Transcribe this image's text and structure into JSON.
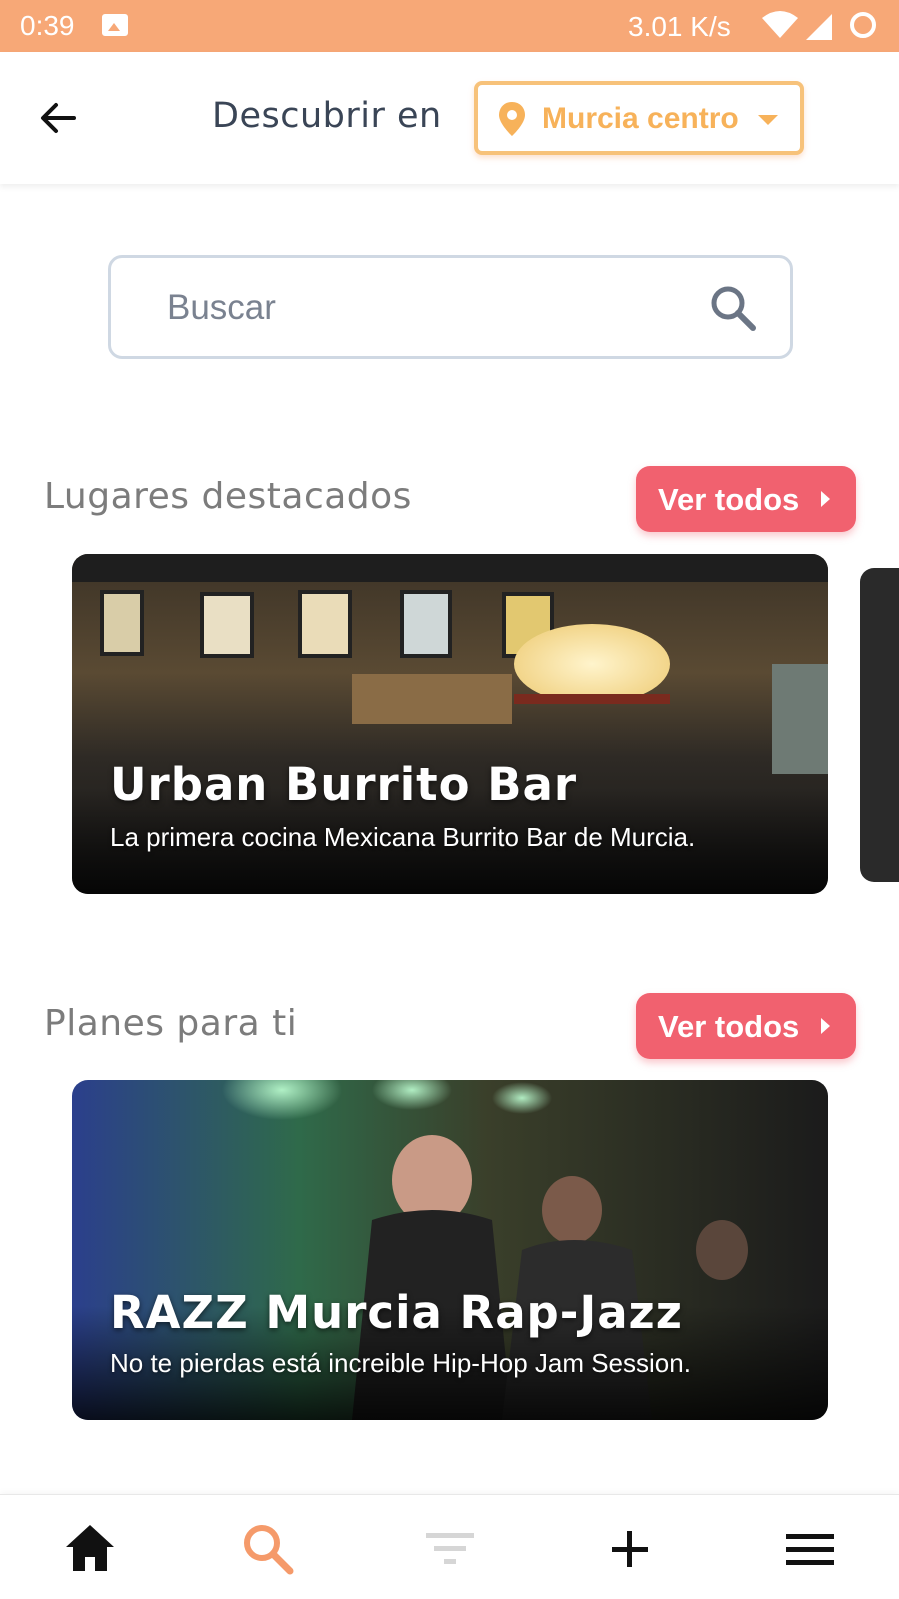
{
  "status_bar": {
    "time": "0:39",
    "speed": "3.01 K/s"
  },
  "header": {
    "title": "Descubrir en",
    "location": "Murcia centro"
  },
  "search": {
    "placeholder": "Buscar"
  },
  "sections": [
    {
      "title": "Lugares destacados",
      "see_all": "Ver todos",
      "card": {
        "title": "Urban Burrito Bar",
        "subtitle": "La primera cocina Mexicana Burrito Bar de Murcia."
      }
    },
    {
      "title": "Planes para ti",
      "see_all": "Ver todos",
      "card": {
        "title": "RAZZ Murcia Rap-Jazz",
        "subtitle": "No te pierdas está increible Hip-Hop Jam Session."
      }
    }
  ],
  "bottom_nav": [
    {
      "icon": "home-icon",
      "active": false
    },
    {
      "icon": "search-icon",
      "active": true
    },
    {
      "icon": "filter-icon",
      "active": false
    },
    {
      "icon": "plus-icon",
      "active": false
    },
    {
      "icon": "menu-icon",
      "active": false
    }
  ],
  "colors": {
    "status_bar": "#f7a877",
    "accent_orange": "#f7b25a",
    "button_red": "#f1616f",
    "nav_active": "#f59a6a"
  }
}
